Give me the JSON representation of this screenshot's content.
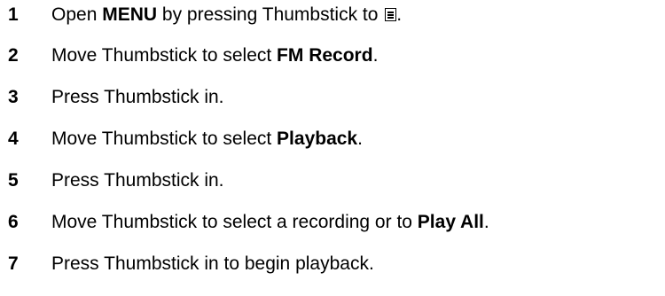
{
  "steps": [
    {
      "number": "1",
      "before": "Open ",
      "bold": "MENU",
      "after": " by pressing Thumbstick to ",
      "icon": "menu-icon",
      "end": "."
    },
    {
      "number": "2",
      "before": "Move Thumbstick to select ",
      "bold": "FM Record",
      "after": "."
    },
    {
      "number": "3",
      "before": "Press Thumbstick in.",
      "bold": "",
      "after": ""
    },
    {
      "number": "4",
      "before": "Move Thumbstick to select ",
      "bold": "Playback",
      "after": "."
    },
    {
      "number": "5",
      "before": "Press Thumbstick in.",
      "bold": "",
      "after": ""
    },
    {
      "number": "6",
      "before": "Move Thumbstick to select a recording or to ",
      "bold": "Play All",
      "after": "."
    },
    {
      "number": "7",
      "before": "Press Thumbstick in to begin playback.",
      "bold": "",
      "after": ""
    }
  ]
}
